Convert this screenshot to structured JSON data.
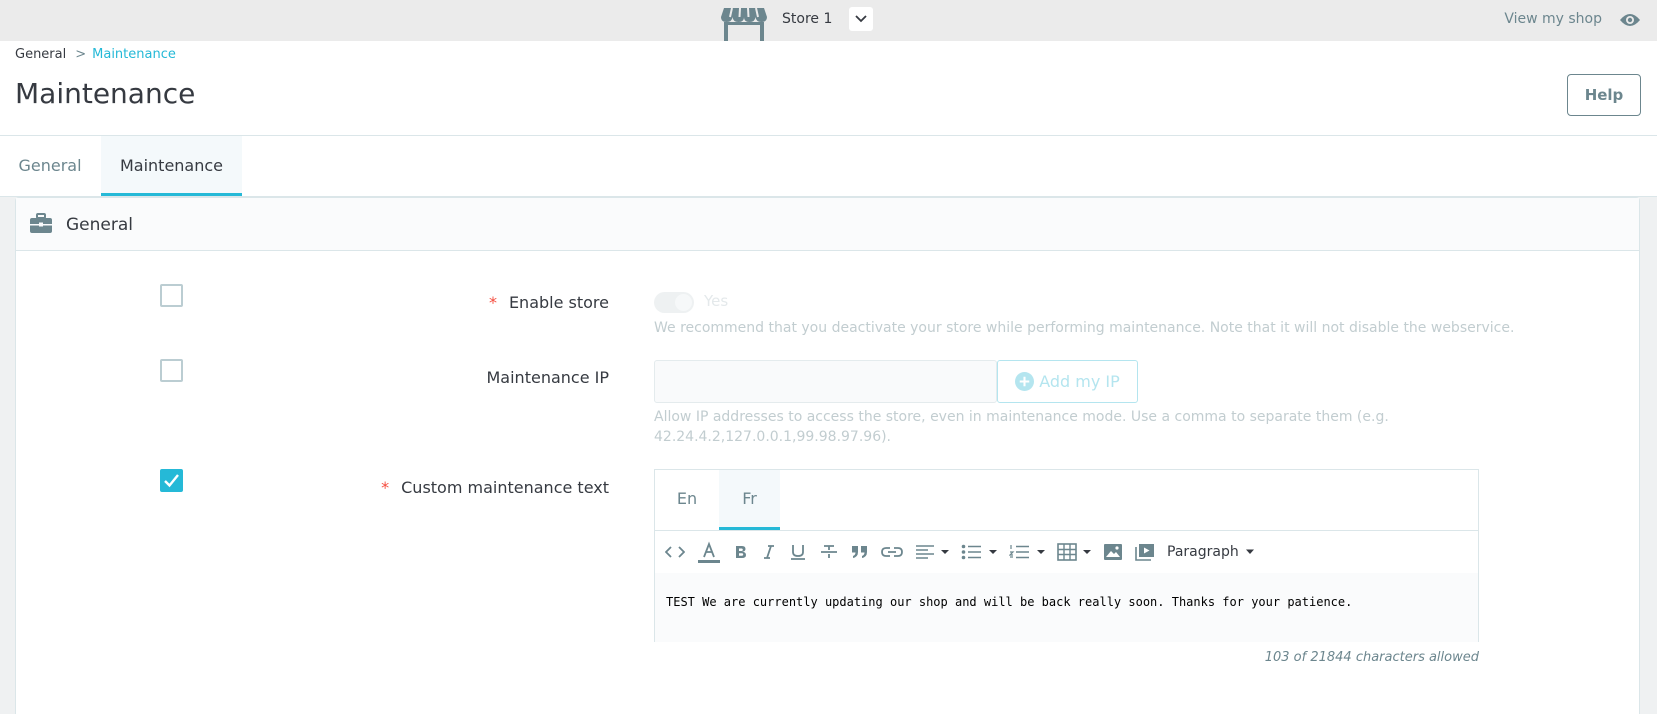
{
  "topbar": {
    "store_name": "Store 1",
    "view_shop_label": "View my shop"
  },
  "breadcrumb": {
    "parent": "General",
    "separator": ">",
    "current": "Maintenance"
  },
  "page": {
    "title": "Maintenance",
    "help_label": "Help"
  },
  "tabs": [
    {
      "label": "General",
      "active": false
    },
    {
      "label": "Maintenance",
      "active": true
    }
  ],
  "panel": {
    "title": "General"
  },
  "fields": {
    "enable_store": {
      "required": "*",
      "label": "Enable store",
      "value_label": "Yes",
      "help": "We recommend that you deactivate your store while performing maintenance. Note that it will not disable the webservice."
    },
    "maintenance_ip": {
      "label": "Maintenance IP",
      "value": "",
      "button_label": "Add my IP",
      "help_line1": "Allow IP addresses to access the store, even in maintenance mode. Use a comma to separate them (e.g.",
      "help_line2": "42.24.4.2,127.0.0.1,99.98.97.96)."
    },
    "custom_text": {
      "required": "*",
      "label": "Custom maintenance text",
      "languages": [
        "En",
        "Fr"
      ],
      "active_language": "Fr",
      "format_label": "Paragraph",
      "content": "TEST We are currently updating our shop and will be back really soon. Thanks for your patience.",
      "counter": "103 of 21844 characters allowed"
    }
  },
  "checkboxes": {
    "enable_store": false,
    "maintenance_ip": false,
    "custom_text": true
  },
  "colors": {
    "accent": "#25b9d7",
    "required": "#f54c3e",
    "text": "#363a41",
    "muted": "#6c868e"
  }
}
